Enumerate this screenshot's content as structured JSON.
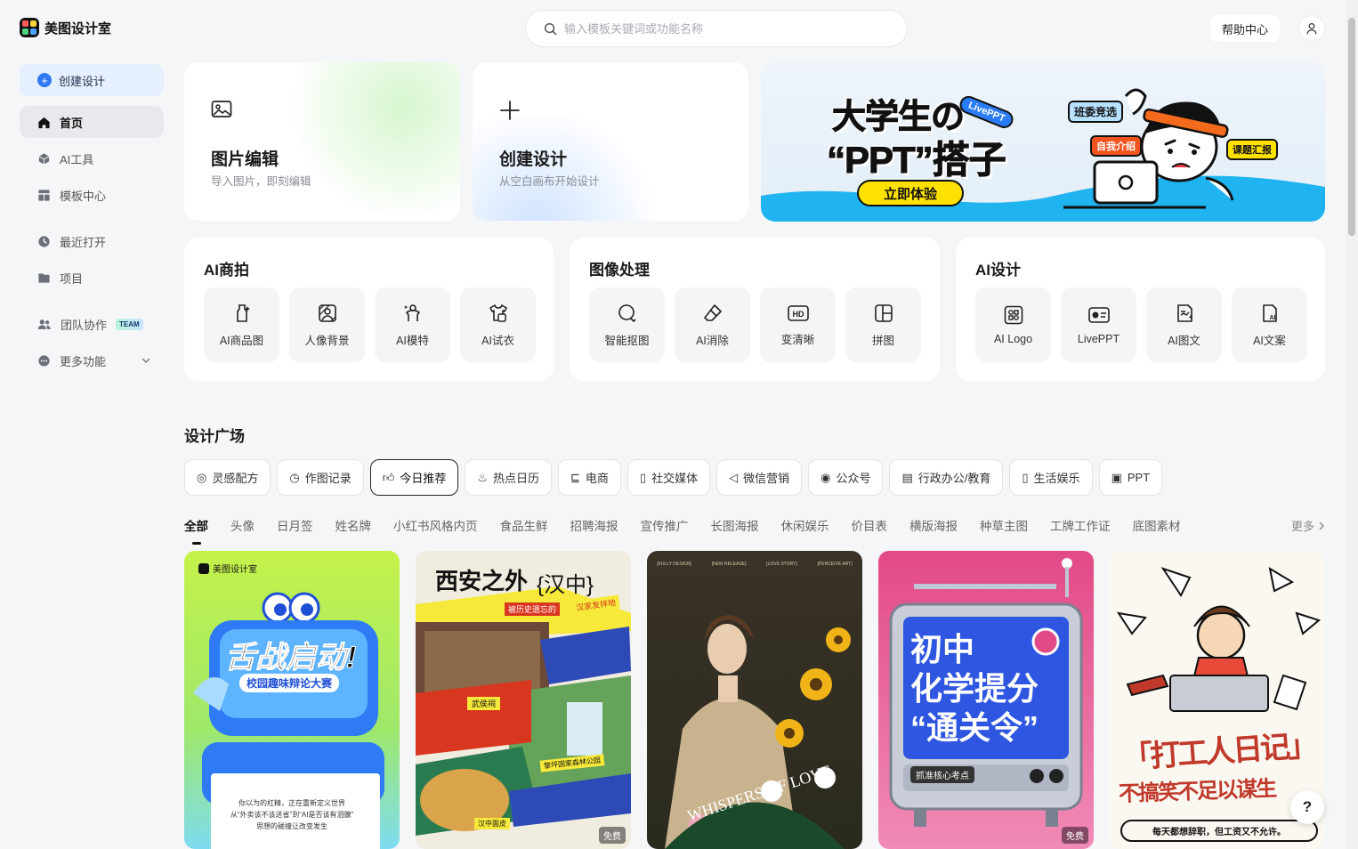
{
  "app": {
    "name": "美图设计室"
  },
  "search": {
    "placeholder": "输入模板关键词或功能名称"
  },
  "header": {
    "help_label": "帮助中心"
  },
  "sidebar": {
    "create_label": "创建设计",
    "items": [
      {
        "label": "首页"
      },
      {
        "label": "AI工具"
      },
      {
        "label": "模板中心"
      },
      {
        "label": "最近打开"
      },
      {
        "label": "项目"
      },
      {
        "label": "团队协作",
        "badge": "TEAM"
      },
      {
        "label": "更多功能"
      }
    ]
  },
  "quick": [
    {
      "title": "图片编辑",
      "subtitle": "导入图片，即刻编辑"
    },
    {
      "title": "创建设计",
      "subtitle": "从空白画布开始设计"
    }
  ],
  "banner": {
    "headline1": "大学生の",
    "headline2": "“PPT”搭子",
    "tag": "LivePPT",
    "cta": "立即体验",
    "bubbles": [
      "班委竞选",
      "自我介绍",
      "课题汇报"
    ]
  },
  "tool_groups": [
    {
      "title": "AI商拍",
      "items": [
        {
          "label": "AI商品图"
        },
        {
          "label": "人像背景"
        },
        {
          "label": "AI模特"
        },
        {
          "label": "AI试衣"
        }
      ]
    },
    {
      "title": "图像处理",
      "items": [
        {
          "label": "智能抠图"
        },
        {
          "label": "AI消除"
        },
        {
          "label": "变清晰"
        },
        {
          "label": "拼图"
        }
      ]
    },
    {
      "title": "AI设计",
      "items": [
        {
          "label": "AI Logo"
        },
        {
          "label": "LivePPT"
        },
        {
          "label": "AI图文"
        },
        {
          "label": "AI文案"
        }
      ]
    }
  ],
  "plaza": {
    "title": "设计广场",
    "chips": [
      {
        "label": "灵感配方"
      },
      {
        "label": "作图记录"
      },
      {
        "label": "今日推荐"
      },
      {
        "label": "热点日历"
      },
      {
        "label": "电商"
      },
      {
        "label": "社交媒体"
      },
      {
        "label": "微信营销"
      },
      {
        "label": "公众号"
      },
      {
        "label": "行政办公/教育"
      },
      {
        "label": "生活娱乐"
      },
      {
        "label": "PPT"
      }
    ],
    "tabs": [
      "全部",
      "头像",
      "日月签",
      "姓名牌",
      "小红书风格内页",
      "食品生鲜",
      "招聘海报",
      "宣传推广",
      "长图海报",
      "休闲娱乐",
      "价目表",
      "横版海报",
      "种草主图",
      "工牌工作证",
      "底图素材"
    ],
    "more_label": "更多"
  },
  "templates": [
    {
      "brand": "美图设计室",
      "title": "舌战启动!",
      "subtitle": "校园趣味辩论大赛",
      "body1": "你以为的杠精，正在重新定义世界",
      "body2": "从“外卖该不该送省”到“AI是否该有泪腺”",
      "body3": "思想的碰撞让改变发生"
    },
    {
      "title": "西安之外",
      "title2": "{汉中}",
      "tag1": "被历史遗忘的",
      "tag2": "汉家发祥地",
      "sign": "武侯祠",
      "label1": "黎坪国家森林公园",
      "label2": "汉中面皮",
      "free": "免费"
    },
    {
      "top": [
        "[FULLY DESIGN]",
        "[NEW RELEASE]",
        "[LOVE STORY]",
        "[PERCEIVE ART]"
      ],
      "script": "WHISPERS OF LOVE"
    },
    {
      "title1": "初中",
      "title2": "化学提分",
      "title3": "“通关令”",
      "badge": "抓准核心考点",
      "free": "免费"
    },
    {
      "title": "「打工人日记」",
      "sub": "不搞笑不足以谋生",
      "foot": "每天都想辞职，但工资又不允许。"
    }
  ],
  "colors": {
    "accent": "#2f7bf5",
    "banner_cta": "#ffe100"
  }
}
